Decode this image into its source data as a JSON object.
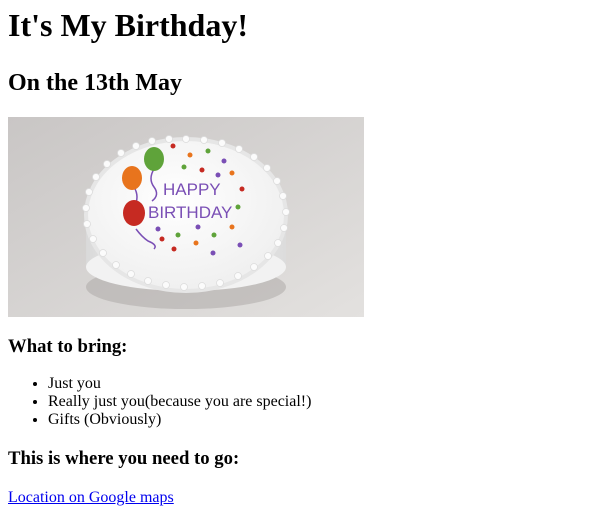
{
  "page": {
    "title": "It's My Birthday!",
    "date": "On the 13th May"
  },
  "image": {
    "alt": "Birthday cake",
    "cake_text_line1": "HAPPY",
    "cake_text_line2": "BIRTHDAY"
  },
  "bring": {
    "heading": "What to bring:",
    "items": [
      "Just you",
      "Really just you(because you are special!)",
      "Gifts (Obviously)"
    ]
  },
  "location": {
    "heading": "This is where you need to go:",
    "link_text": "Location on Google maps"
  },
  "colors": {
    "link": "#0000ee",
    "frosting_text": "#7a4fb5"
  }
}
